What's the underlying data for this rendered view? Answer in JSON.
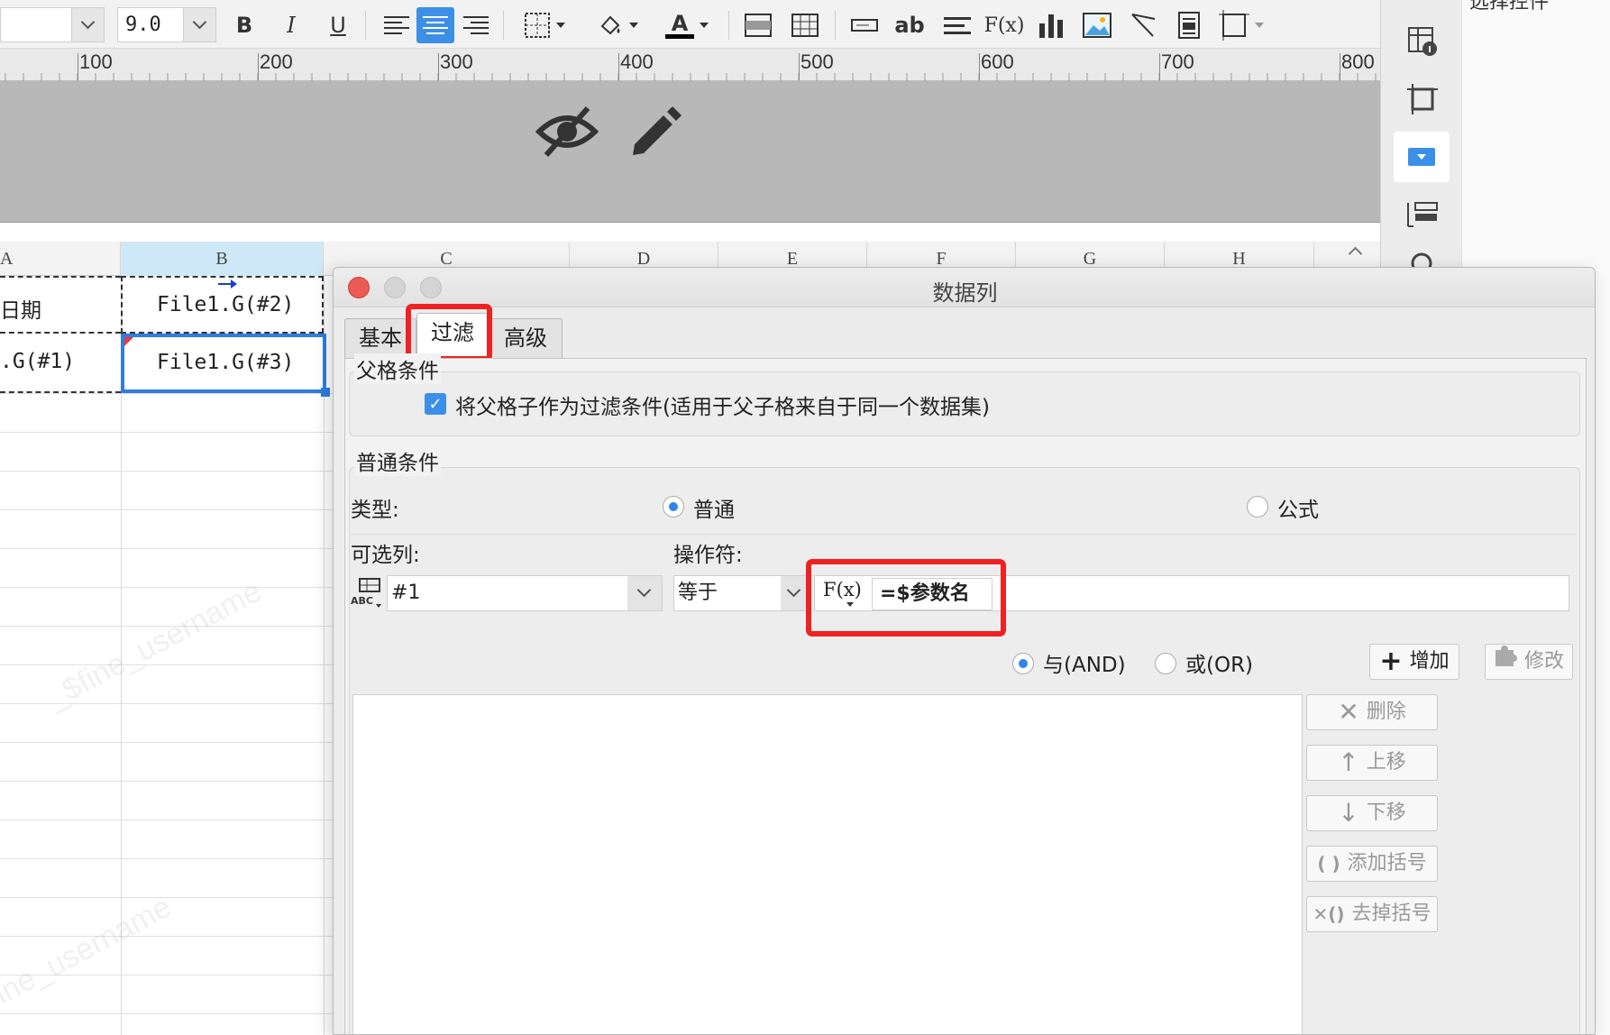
{
  "toolbar": {
    "font_size": "9.0",
    "bold": "B",
    "italic": "I",
    "underline": "U",
    "font_color_glyph": "A",
    "text_ab": "ab",
    "formula_glyph": "F(x)"
  },
  "ruler": {
    "labels": [
      "100",
      "200",
      "300",
      "400",
      "500",
      "600",
      "700",
      "800"
    ]
  },
  "right_panel": {
    "top_text": "选择控件"
  },
  "sheet": {
    "columns": [
      "A",
      "B",
      "C",
      "D",
      "E",
      "F",
      "G",
      "H"
    ],
    "cells": {
      "a1": "日期",
      "b1": "File1.G(#2)",
      "a2": ".G(#1)",
      "b2": "File1.G(#3)"
    },
    "watermark": "_$fine_username"
  },
  "dialog": {
    "title": "数据列",
    "tabs": [
      {
        "label": "基本",
        "active": false
      },
      {
        "label": "过滤",
        "active": true
      },
      {
        "label": "高级",
        "active": false
      }
    ],
    "parent_group": {
      "title": "父格条件",
      "checkbox_label": "将父格子作为过滤条件(适用于父子格来自于同一个数据集)",
      "checked": true
    },
    "normal_group": {
      "title": "普通条件",
      "type_label": "类型:",
      "type_options": [
        "普通",
        "公式"
      ],
      "type_selected": "普通",
      "optional_col_label": "可选列:",
      "operator_label": "操作符:",
      "column_value": "#1",
      "operator_value": "等于",
      "formula_icon": "F(x)",
      "value": "=$参数名",
      "logic_options": [
        "与(AND)",
        "或(OR)"
      ],
      "logic_selected": "与(AND)",
      "add_button": "增加",
      "modify_button": "修改",
      "side_buttons": [
        "删除",
        "上移",
        "下移",
        "添加括号",
        "去掉括号"
      ]
    }
  },
  "colors": {
    "highlight": "#ee2222",
    "accent": "#3b8fe6",
    "selection": "#2f7de1"
  }
}
